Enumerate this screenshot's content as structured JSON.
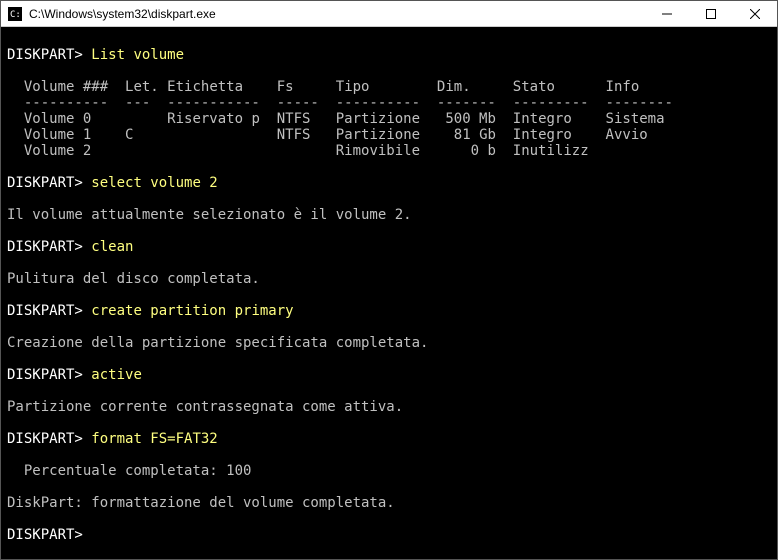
{
  "window": {
    "title": "C:\\Windows\\system32\\diskpart.exe"
  },
  "prompt": "DISKPART>",
  "commands": {
    "list_volume": "List volume",
    "select_volume": "select volume 2",
    "clean": "clean",
    "create_partition": "create partition primary",
    "active": "active",
    "format": "format FS=FAT32"
  },
  "table": {
    "headers": {
      "volume_num": "Volume ###",
      "letter": "Let.",
      "label": "Etichetta",
      "fs": "Fs",
      "type": "Tipo",
      "size": "Dim.",
      "state": "Stato",
      "info": "Info"
    },
    "rows": [
      {
        "num": "Volume 0",
        "let": "",
        "label": "Riservato p",
        "fs": "NTFS",
        "type": "Partizione",
        "size": "500 Mb",
        "state": "Integro",
        "info": "Sistema"
      },
      {
        "num": "Volume 1",
        "let": "C",
        "label": "",
        "fs": "NTFS",
        "type": "Partizione",
        "size": "81 Gb",
        "state": "Integro",
        "info": "Avvio"
      },
      {
        "num": "Volume 2",
        "let": "",
        "label": "",
        "fs": "",
        "type": "Rimovibile",
        "size": "0 b",
        "state": "Inutilizz",
        "info": ""
      }
    ]
  },
  "messages": {
    "selected": "Il volume attualmente selezionato è il volume 2.",
    "cleaned": "Pulitura del disco completata.",
    "created": "Creazione della partizione specificata completata.",
    "active": "Partizione corrente contrassegnata come attiva.",
    "percent": "  Percentuale completata: 100",
    "formatted": "DiskPart: formattazione del volume completata."
  }
}
